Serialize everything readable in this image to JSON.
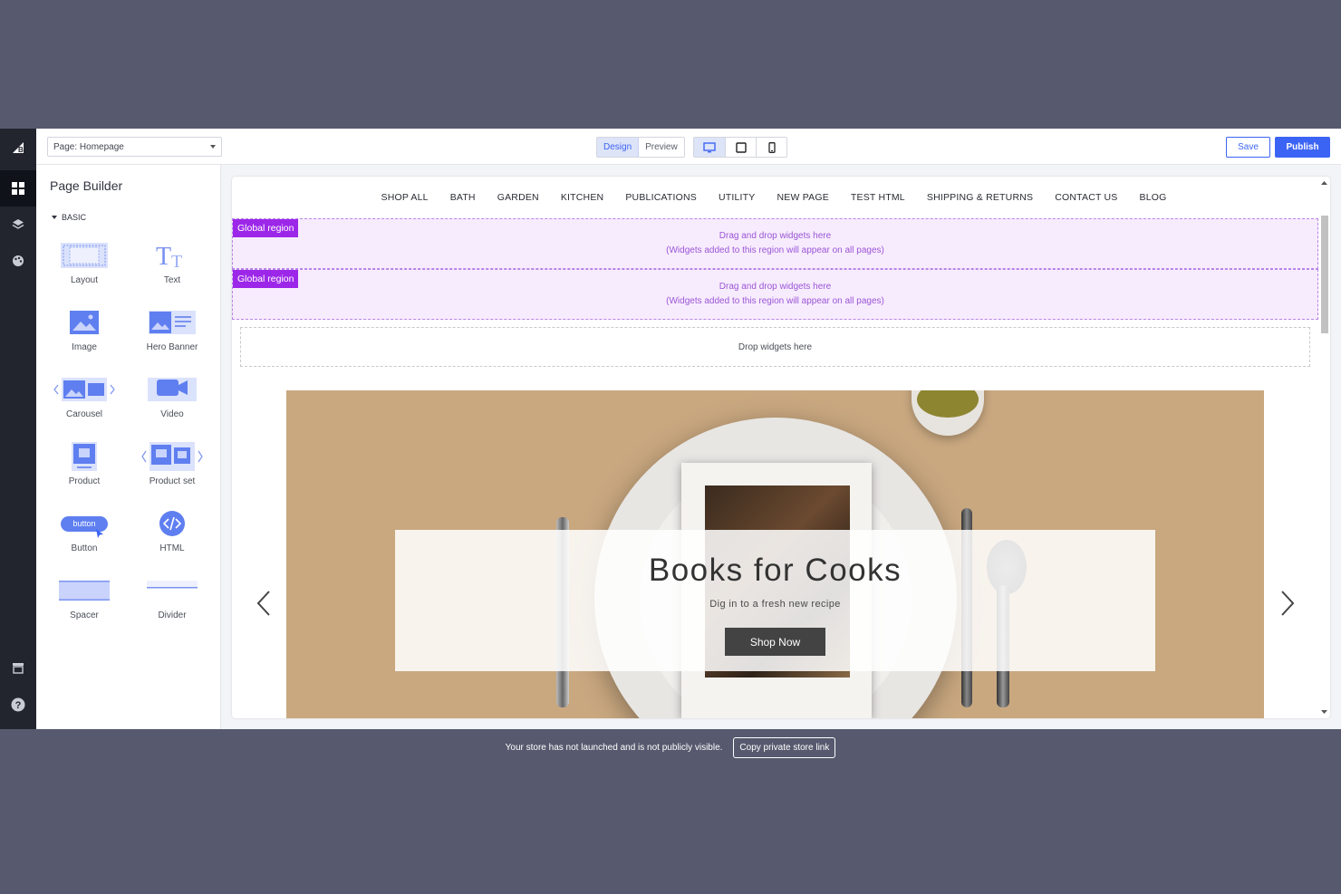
{
  "toolbar": {
    "page_select": "Page: Homepage",
    "modes": [
      "Design",
      "Preview"
    ],
    "save_label": "Save",
    "publish_label": "Publish"
  },
  "panel": {
    "title": "Page Builder",
    "section": "BASIC",
    "widgets": [
      "Layout",
      "Text",
      "Image",
      "Hero Banner",
      "Carousel",
      "Video",
      "Product",
      "Product set",
      "Button",
      "HTML",
      "Spacer",
      "Divider"
    ],
    "button_widget_inner": "button"
  },
  "nav": {
    "items": [
      "SHOP ALL",
      "BATH",
      "GARDEN",
      "KITCHEN",
      "PUBLICATIONS",
      "UTILITY",
      "NEW PAGE",
      "TEST HTML",
      "SHIPPING & RETURNS",
      "CONTACT US",
      "BLOG"
    ]
  },
  "regions": [
    {
      "tag": "Global region",
      "line1": "Drag and drop widgets here",
      "line2": "(Widgets added to this region will appear on all pages)"
    },
    {
      "tag": "Global region",
      "line1": "Drag and drop widgets here",
      "line2": "(Widgets added to this region will appear on all pages)"
    }
  ],
  "drop_zone": "Drop widgets here",
  "hero": {
    "title": "Books for Cooks",
    "subtitle": "Dig in to a fresh new recipe",
    "button": "Shop Now"
  },
  "footer": {
    "notice": "Your store has not launched and is not publicly visible.",
    "button": "Copy private store link"
  },
  "colors": {
    "accent": "#3c64f4",
    "global_region": "#9c27e8",
    "rail": "#22252e"
  }
}
